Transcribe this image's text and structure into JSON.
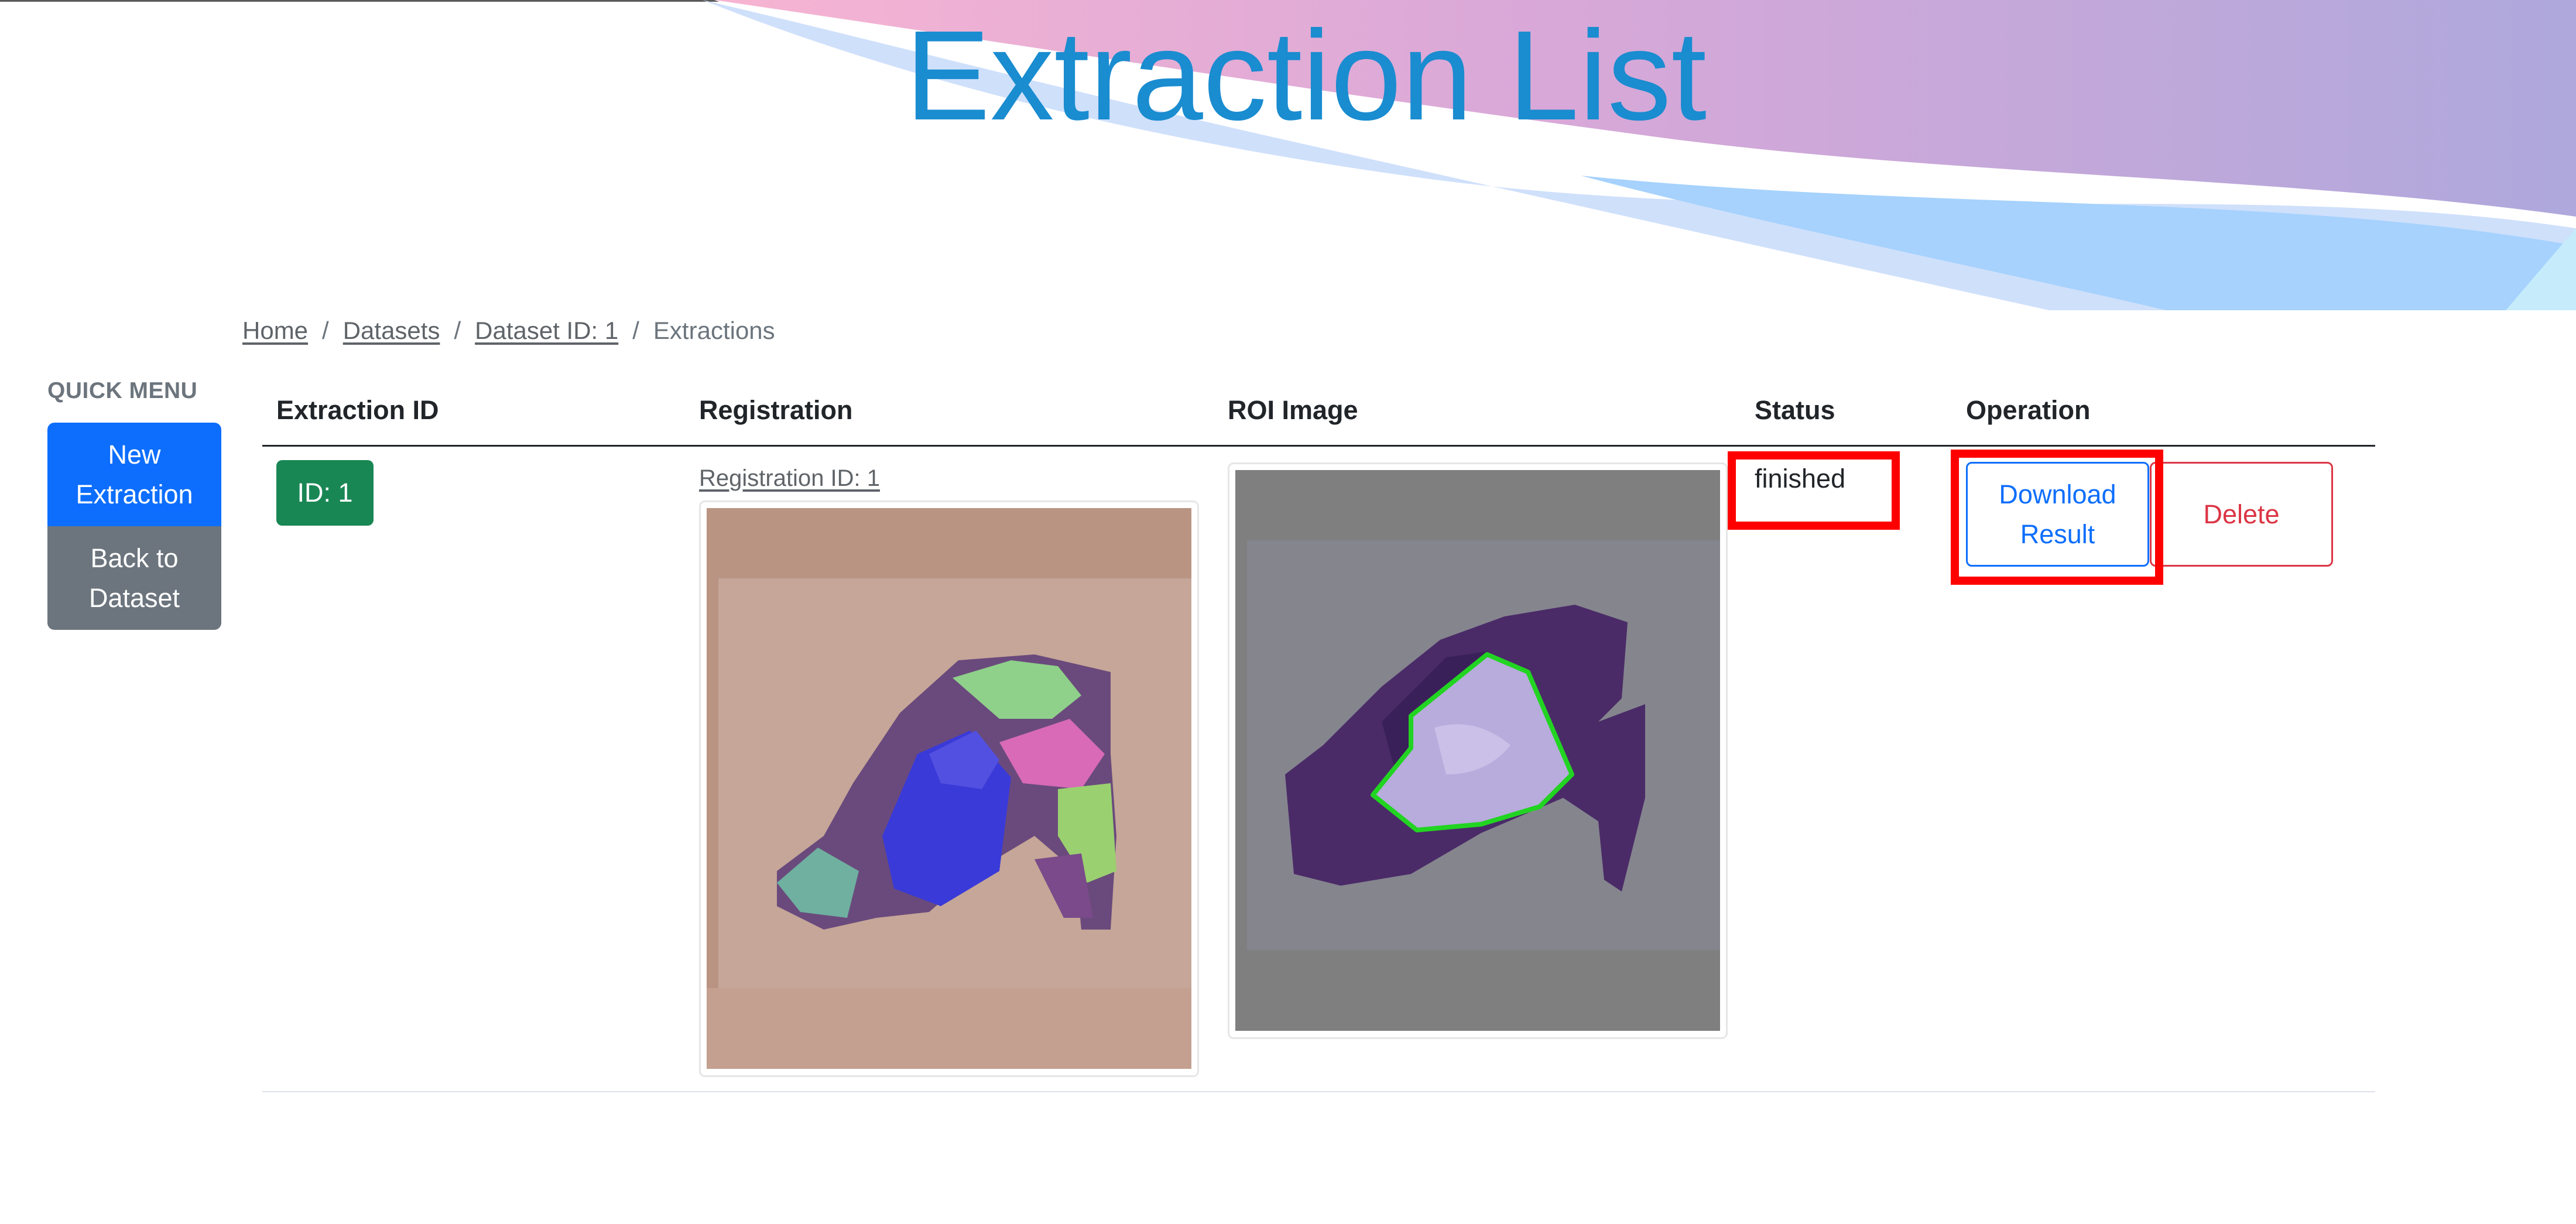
{
  "page": {
    "title": "Extraction List"
  },
  "breadcrumb": {
    "home": "Home",
    "datasets": "Datasets",
    "dataset": "Dataset ID: 1",
    "current": "Extractions",
    "separator": "/"
  },
  "quick_menu": {
    "title": "QUICK MENU",
    "new_extraction": [
      "New",
      "Extraction"
    ],
    "back_to_dataset": [
      "Back to",
      "Dataset"
    ]
  },
  "table": {
    "headers": [
      "Extraction ID",
      "Registration",
      "ROI Image",
      "Status",
      "Operation"
    ],
    "rows": [
      {
        "id_badge": "ID: 1",
        "registration_link": "Registration ID: 1",
        "status": "finished",
        "download_label": [
          "Download",
          "Result"
        ],
        "delete_label": "Delete"
      }
    ]
  },
  "colors": {
    "title": "#1a8cd0",
    "primary": "#0d6efd",
    "secondary": "#6c757d",
    "success": "#198754",
    "danger": "#dc3545",
    "highlight": "#ff0000"
  }
}
